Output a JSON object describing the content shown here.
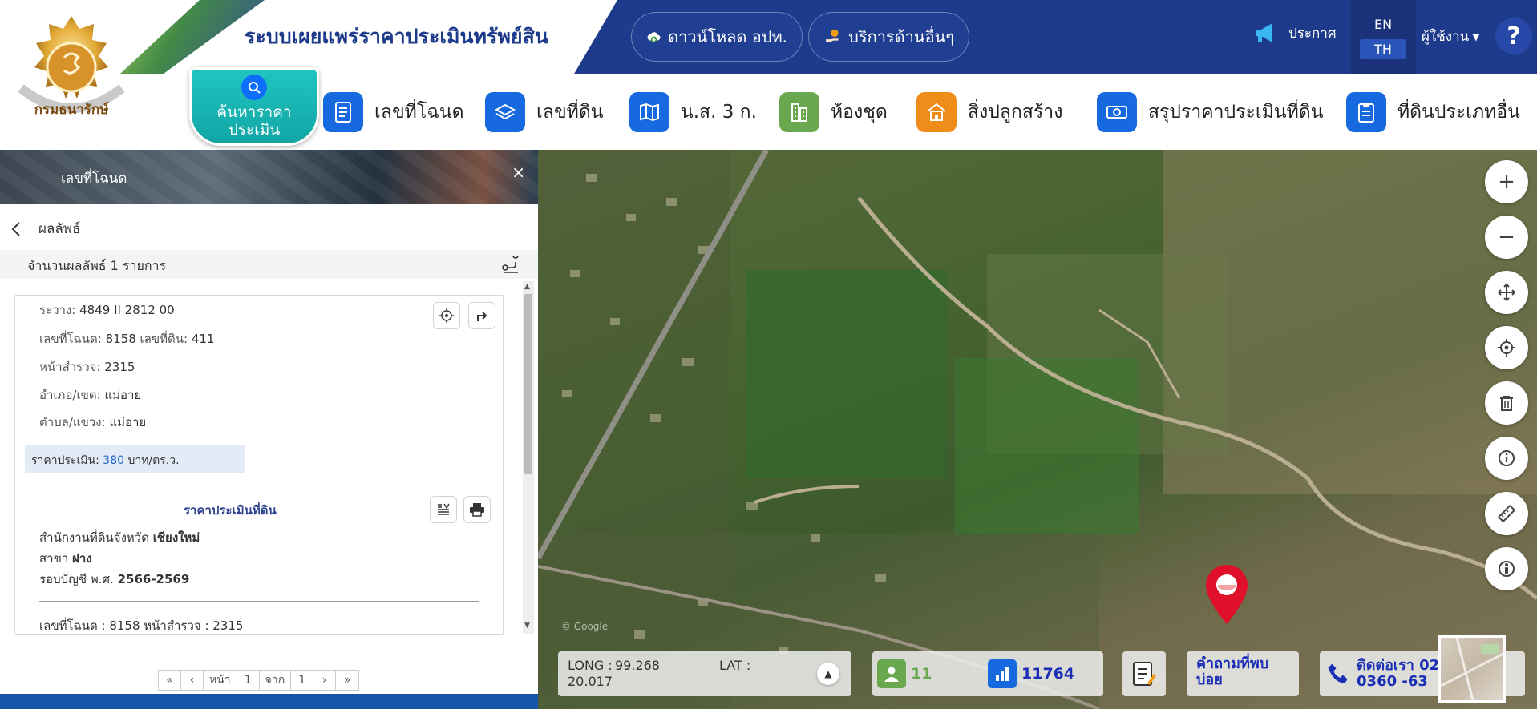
{
  "header": {
    "title": "ระบบเผยแพร่ราคาประเมินทรัพย์สิน",
    "download_label": "ดาวน์โหลด อปท.",
    "service_label": "บริการด้านอื่นๆ",
    "announce_label": "ประกาศ",
    "lang_en": "EN",
    "lang_th": "TH",
    "user_label": "ผู้ใช้งาน",
    "help_label": "?",
    "logo_text": "กรมธนารักษ์"
  },
  "nav": {
    "search_label": "ค้นหาราคาประเมิน",
    "items": [
      {
        "label": "เลขที่โฉนด",
        "icon": "document-icon",
        "color": "#1769e0"
      },
      {
        "label": "เลขที่ดิน",
        "icon": "layers-icon",
        "color": "#1769e0"
      },
      {
        "label": "น.ส. 3 ก.",
        "icon": "map-icon",
        "color": "#1769e0"
      },
      {
        "label": "ห้องชุด",
        "icon": "building-icon",
        "color": "#6aa84f"
      },
      {
        "label": "สิ่งปลูกสร้าง",
        "icon": "house-icon",
        "color": "#f08c1a"
      },
      {
        "label": "สรุปราคาประเมินที่ดิน",
        "icon": "money-icon",
        "color": "#1769e0"
      },
      {
        "label": "ที่ดินประเภทอื่น",
        "icon": "clipboard-icon",
        "color": "#1769e0"
      }
    ]
  },
  "panel": {
    "title": "เลขที่โฉนด",
    "close": "×",
    "back_label": "ผลลัพธ์",
    "result_count": "จำนวนผลลัพธ์ 1 รายการ",
    "record": {
      "rawang_label": "ระวาง:",
      "rawang_value": "4849 II 2812 00",
      "deed_label": "เลขที่โฉนด:",
      "deed_value": "8158",
      "land_label": "เลขที่ดิน:",
      "land_value": "411",
      "survey_label": "หน้าสำรวจ:",
      "survey_value": "2315",
      "district_label": "อำเภอ/เขต:",
      "district_value": "แม่อาย",
      "subdistrict_label": "ตำบล/แขวง:",
      "subdistrict_value": "แม่อาย",
      "price_label": "ราคาประเมิน:",
      "price_value": "380",
      "price_unit": "บาท/ตร.ว."
    },
    "section_title": "ราคาประเมินที่ดิน",
    "office_prefix": "สำนักงานที่ดินจังหวัด",
    "office_province": "เชียงใหม่",
    "branch_prefix": "สาขา",
    "branch_name": "ฝาง",
    "period_prefix": "รอบบัญชี พ.ศ.",
    "period_value": "2566-2569",
    "deed_summary": "เลขที่โฉนด : 8158 หน้าสำรวจ : 2315",
    "pager": {
      "first": "«",
      "prev": "‹",
      "page_label": "หน้า",
      "page": "1",
      "of_label": "จาก",
      "total": "1",
      "next": "›",
      "last": "»"
    }
  },
  "map": {
    "long_label": "LONG :",
    "long_value": "99.268",
    "lat_label": "LAT :",
    "lat_value": "20.017",
    "visitor_count": "11",
    "stats_count": "11764",
    "faq_label": "คำถามที่พบบ่อย",
    "contact_label": "ติดต่อเรา 02 270 0360 -63",
    "tools": [
      "zoom-in-icon",
      "zoom-out-icon",
      "pan-icon",
      "locate-icon",
      "trash-icon",
      "info-icon",
      "ruler-icon",
      "street-view-icon"
    ]
  },
  "colors": {
    "primary": "#1e3a8a",
    "accent": "#1769e0",
    "teal": "#12a5a6",
    "marker": "#e0102a"
  }
}
